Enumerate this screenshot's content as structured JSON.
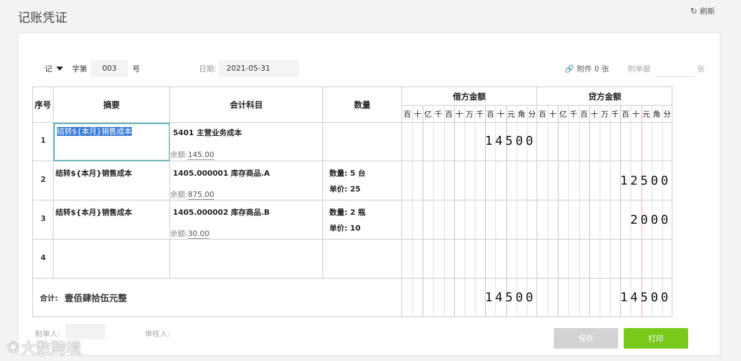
{
  "page": {
    "title": "记账凭证",
    "refresh_label": "刷新"
  },
  "header": {
    "word": "记",
    "word_label": "字第",
    "voucher_no": "003",
    "no_suffix": "号",
    "date_label": "日期:",
    "date_value": "2021-05-31",
    "attachment_label": "附件 0 张",
    "attach_doc_label": "附单据",
    "attach_doc_suffix": "张"
  },
  "table": {
    "headers": {
      "idx": "序号",
      "summary": "摘要",
      "account": "会计科目",
      "qty": "数量",
      "debit": "借方金额",
      "credit": "贷方金额"
    },
    "units": [
      "百",
      "十",
      "亿",
      "千",
      "百",
      "十",
      "万",
      "千",
      "百",
      "十",
      "元",
      "角",
      "分"
    ],
    "rows": [
      {
        "idx": "1",
        "summary": "结转${本月}销售成本",
        "account": "5401 主营业务成本",
        "balance_label": "余额:",
        "balance": "145.00",
        "qty": "",
        "price": "",
        "debit": "14500",
        "credit": ""
      },
      {
        "idx": "2",
        "summary": "结转${本月}销售成本",
        "account": "1405.000001 库存商品.A",
        "balance_label": "余额:",
        "balance": "875.00",
        "qty": "数量: 5 台",
        "price": "单价: 25",
        "debit": "",
        "credit": "12500"
      },
      {
        "idx": "3",
        "summary": "结转${本月}销售成本",
        "account": "1405.000002 库存商品.B",
        "balance_label": "余额:",
        "balance": "30.00",
        "qty": "数量: 2 瓶",
        "price": "单价: 10",
        "debit": "",
        "credit": "2000"
      },
      {
        "idx": "4",
        "summary": "",
        "account": "",
        "balance_label": "",
        "balance": "",
        "qty": "",
        "price": "",
        "debit": "",
        "credit": ""
      }
    ],
    "total": {
      "label": "合计:",
      "words": "壹佰肆拾伍元整",
      "debit": "14500",
      "credit": "14500"
    }
  },
  "footer": {
    "preparer_label": "制单人:",
    "reviewer_label": "审核人:",
    "save_label": "保存",
    "print_label": "打印"
  },
  "watermark": "大数跨境"
}
